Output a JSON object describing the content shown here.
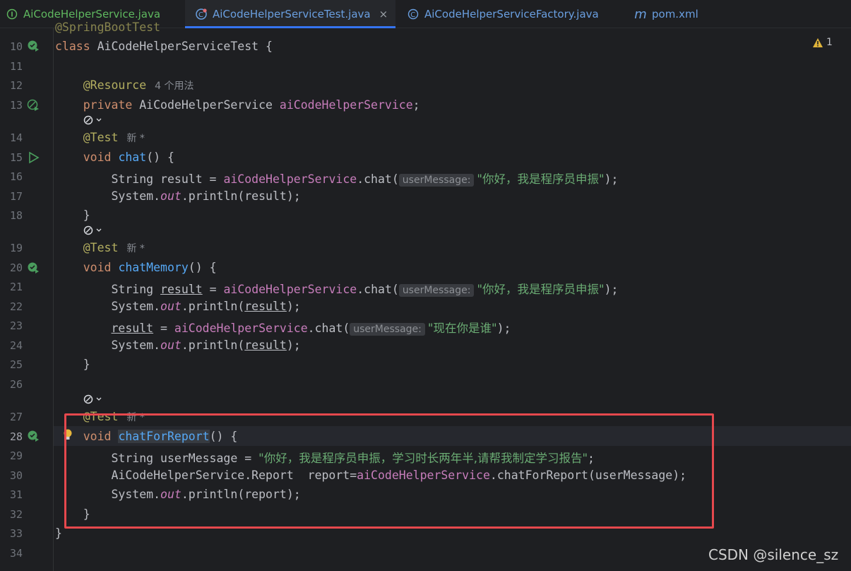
{
  "tabs": [
    {
      "label": "AiCodeHelperService.java",
      "icon": "interface-icon"
    },
    {
      "label": "AiCodeHelperServiceTest.java",
      "icon": "test-class-icon",
      "active": true
    },
    {
      "label": "AiCodeHelperServiceFactory.java",
      "icon": "class-icon"
    },
    {
      "label": "pom.xml",
      "icon": "maven-icon"
    }
  ],
  "tab_close": "×",
  "warning_count": "1",
  "line_numbers": [
    "10",
    "11",
    "12",
    "13",
    "14",
    "15",
    "16",
    "17",
    "18",
    "19",
    "20",
    "21",
    "22",
    "23",
    "24",
    "25",
    "26",
    "27",
    "28",
    "29",
    "30",
    "31",
    "32",
    "33",
    "34"
  ],
  "code": {
    "l10": {
      "kw": "class",
      "name": "AiCodeHelperServiceTest {"
    },
    "l12": {
      "ann": "@Resource",
      "usage": "4 个用法"
    },
    "l13": {
      "kw": "private",
      "type": "AiCodeHelperService",
      "fld": "aiCodeHelperService",
      "end": ";"
    },
    "l14": {
      "ann": "@Test",
      "usage": "新 *"
    },
    "l15": {
      "kw": "void",
      "fn": "chat",
      "end": "() {"
    },
    "l16": {
      "a": "String result = ",
      "fld": "aiCodeHelperService",
      "b": ".chat(",
      "hint": "userMessage:",
      "str": "\"你好，我是程序员申振\"",
      "end": ");"
    },
    "l17": {
      "a": "System.",
      "st": "out",
      "b": ".println(result);"
    },
    "l18": {
      "a": "}"
    },
    "l19": {
      "ann": "@Test",
      "usage": "新 *"
    },
    "l20": {
      "kw": "void",
      "fn": "chatMemory",
      "end": "() {"
    },
    "l21": {
      "a": "String ",
      "u": "result",
      "b": " = ",
      "fld": "aiCodeHelperService",
      "c": ".chat(",
      "hint": "userMessage:",
      "str": "\"你好，我是程序员申振\"",
      "end": ");"
    },
    "l22": {
      "a": "System.",
      "st": "out",
      "b": ".println(",
      "u": "result",
      "end": ");"
    },
    "l23": {
      "u": "result",
      "a": " = ",
      "fld": "aiCodeHelperService",
      "b": ".chat(",
      "hint": "userMessage:",
      "str": "\"现在你是谁\"",
      "end": ");"
    },
    "l24": {
      "a": "System.",
      "st": "out",
      "b": ".println(",
      "u": "result",
      "end": ");"
    },
    "l25": {
      "a": "}"
    },
    "l27": {
      "ann": "@Test",
      "usage": "新 *"
    },
    "l28": {
      "kw": "void",
      "fn": "chatForReport",
      "end": "() {"
    },
    "l29": {
      "a": "String userMessage = ",
      "str": "\"你好，我是程序员申振，学习时长两年半,请帮我制定学习报告\"",
      "end": ";"
    },
    "l30": {
      "a": "AiCodeHelperService.Report  report=",
      "fld": "aiCodeHelperService",
      "b": ".chatForReport(userMessage);"
    },
    "l31": {
      "a": "System.",
      "st": "out",
      "b": ".println(report);"
    },
    "l32": {
      "a": "}"
    },
    "l33": {
      "a": "}"
    }
  },
  "lens_icon": "code-lens-icon",
  "colors": {
    "keyword": "#cf8e6d",
    "annotation": "#b3ae60",
    "function": "#56a8f5",
    "field": "#c77dbb",
    "string": "#6aab73",
    "highlight": "#e5484d"
  },
  "watermark": "CSDN @silence_sz"
}
